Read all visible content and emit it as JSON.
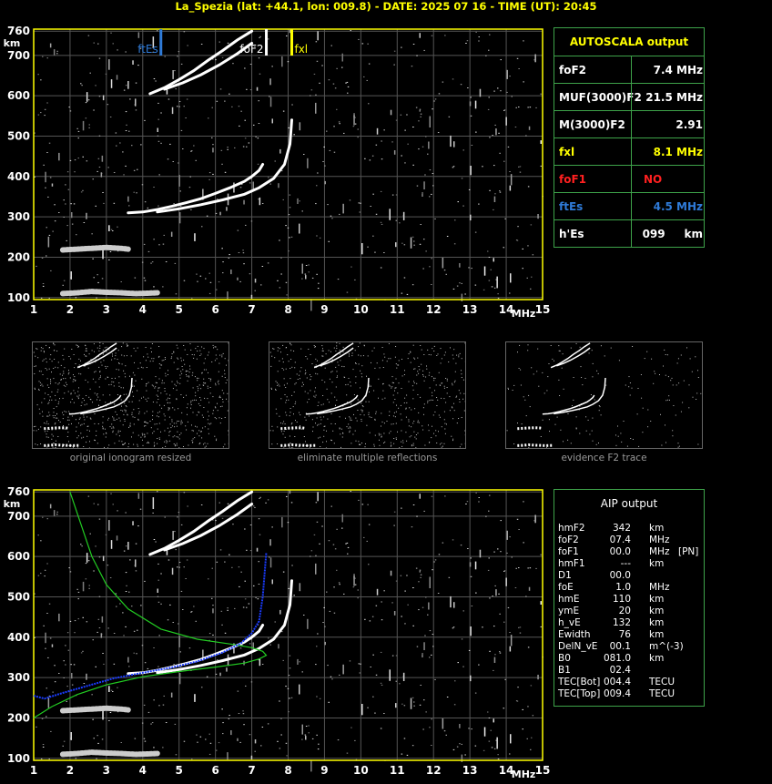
{
  "header": {
    "title": "La_Spezia (lat: +44.1, lon: 009.8) - DATE: 2025 07 16 - TIME (UT): 20:45"
  },
  "colors": {
    "axis": "#ffff00",
    "grid": "#555555",
    "panel_border": "#3ea34a",
    "fte": "#2f7bd8",
    "fof2": "#ffffff",
    "fxl": "#ffff00",
    "model": "#22cc22",
    "profile": "#1a3cff",
    "nofof1": "#ff2020"
  },
  "chart_data": [
    {
      "type": "scatter",
      "name_panel": "top-ionogram",
      "xlabel": "MHz",
      "ylabel": "km",
      "xlim": [
        1,
        15
      ],
      "ylim": [
        95,
        765
      ],
      "xticks": [
        1,
        2,
        3,
        4,
        5,
        6,
        7,
        8,
        9,
        10,
        11,
        12,
        13,
        14,
        15
      ],
      "yticks": [
        100,
        200,
        300,
        400,
        500,
        600,
        700,
        760
      ],
      "grid": true,
      "markers": [
        {
          "label": "ftEs",
          "x": 4.5,
          "color": "#2f7bd8"
        },
        {
          "label": "foF2",
          "x": 7.4,
          "color": "#ffffff"
        },
        {
          "label": "fxl",
          "x": 8.1,
          "color": "#ffff00"
        }
      ],
      "traces": [
        {
          "name": "o-trace",
          "x": [
            3.6,
            4.0,
            4.4,
            4.8,
            5.2,
            5.6,
            6.0,
            6.4,
            6.8,
            7.0,
            7.2,
            7.3
          ],
          "y": [
            310,
            312,
            318,
            326,
            335,
            345,
            358,
            372,
            388,
            400,
            415,
            430
          ]
        },
        {
          "name": "x-trace",
          "x": [
            4.4,
            5.0,
            5.6,
            6.2,
            6.8,
            7.2,
            7.6,
            7.9,
            8.05,
            8.1
          ],
          "y": [
            312,
            320,
            330,
            342,
            356,
            372,
            395,
            430,
            480,
            540
          ]
        },
        {
          "name": "2nd-hop",
          "x": [
            4.2,
            4.6,
            5.0,
            5.4,
            5.8,
            6.2,
            6.6,
            7.0
          ],
          "y": [
            605,
            620,
            640,
            662,
            688,
            712,
            738,
            760
          ]
        },
        {
          "name": "2nd-hop-x",
          "x": [
            4.6,
            5.1,
            5.6,
            6.1,
            6.6,
            7.0
          ],
          "y": [
            616,
            632,
            652,
            676,
            704,
            730
          ]
        },
        {
          "name": "Es-1",
          "x": [
            1.8,
            2.2,
            2.6,
            3.0,
            3.4,
            3.8,
            4.2,
            4.4
          ],
          "y": [
            110,
            112,
            115,
            113,
            112,
            110,
            111,
            112
          ]
        },
        {
          "name": "Es-2",
          "x": [
            1.8,
            2.2,
            2.6,
            3.0,
            3.4,
            3.6
          ],
          "y": [
            218,
            220,
            222,
            224,
            222,
            220
          ]
        }
      ]
    },
    {
      "type": "scatter",
      "name_panel": "bottom-ionogram",
      "xlabel": "MHz",
      "ylabel": "km",
      "xlim": [
        1,
        15
      ],
      "ylim": [
        95,
        765
      ],
      "xticks": [
        1,
        2,
        3,
        4,
        5,
        6,
        7,
        8,
        9,
        10,
        11,
        12,
        13,
        14,
        15
      ],
      "yticks": [
        100,
        200,
        300,
        400,
        500,
        600,
        700,
        760
      ],
      "grid": true,
      "model_curve": {
        "x": [
          1.0,
          1.5,
          2.2,
          3.0,
          4.0,
          5.0,
          6.0,
          6.8,
          7.2,
          7.4,
          7.3,
          7.0,
          6.5,
          5.5,
          4.5,
          3.6,
          3.0,
          2.6,
          2.3,
          2.0
        ],
        "y": [
          200,
          228,
          258,
          282,
          302,
          315,
          326,
          336,
          346,
          355,
          365,
          374,
          382,
          395,
          420,
          470,
          530,
          600,
          680,
          760
        ]
      },
      "profile_curve": {
        "x": [
          1.0,
          1.3,
          1.8,
          2.5,
          3.2,
          4.0,
          4.8,
          5.5,
          6.2,
          6.7,
          7.0,
          7.2,
          7.3,
          7.4
        ],
        "y": [
          255,
          248,
          262,
          280,
          298,
          312,
          325,
          340,
          362,
          385,
          410,
          440,
          500,
          610
        ]
      }
    }
  ],
  "autoscala": {
    "title": "AUTOSCALA output",
    "rows": [
      {
        "label": "foF2",
        "value": "7.4 MHz",
        "color": "#ffffff"
      },
      {
        "label": "MUF(3000)F2",
        "value": "21.5 MHz",
        "color": "#ffffff"
      },
      {
        "label": "M(3000)F2",
        "value": "2.91",
        "color": "#ffffff"
      },
      {
        "label": "fxl",
        "value": "8.1 MHz",
        "color": "#ffff00"
      },
      {
        "label": "foF1",
        "value": "NO",
        "color": "#ff2020"
      },
      {
        "label": "ftEs",
        "value": "4.5 MHz",
        "color": "#2f7bd8"
      },
      {
        "label": "h'Es",
        "value": "099     km",
        "color": "#ffffff"
      }
    ]
  },
  "aip": {
    "title": "AIP output",
    "rows": [
      {
        "label": "hmF2",
        "value": "342",
        "unit": "km",
        "extra": ""
      },
      {
        "label": "foF2",
        "value": "07.4",
        "unit": "MHz",
        "extra": ""
      },
      {
        "label": "foF1",
        "value": "00.0",
        "unit": "MHz",
        "extra": "[PN]"
      },
      {
        "label": "hmF1",
        "value": "---",
        "unit": "km",
        "extra": ""
      },
      {
        "label": "D1",
        "value": "00.0",
        "unit": "",
        "extra": ""
      },
      {
        "label": "foE",
        "value": "1.0",
        "unit": "MHz",
        "extra": ""
      },
      {
        "label": "hmE",
        "value": "110",
        "unit": "km",
        "extra": ""
      },
      {
        "label": "ymE",
        "value": "20",
        "unit": "km",
        "extra": ""
      },
      {
        "label": "h_vE",
        "value": "132",
        "unit": "km",
        "extra": ""
      },
      {
        "label": "Ewidth",
        "value": "76",
        "unit": "km",
        "extra": ""
      },
      {
        "label": "DelN_vE",
        "value": "00.1",
        "unit": "m^(-3)",
        "extra": ""
      },
      {
        "label": "B0",
        "value": "081.0",
        "unit": "km",
        "extra": ""
      },
      {
        "label": "B1",
        "value": "02.4",
        "unit": "",
        "extra": ""
      },
      {
        "label": "TEC[Bot]",
        "value": "004.4",
        "unit": "TECU",
        "extra": ""
      },
      {
        "label": "TEC[Top]",
        "value": "009.4",
        "unit": "TECU",
        "extra": ""
      }
    ]
  },
  "thumbnails": [
    {
      "caption": "original ionogram resized"
    },
    {
      "caption": "eliminate multiple reflections"
    },
    {
      "caption": "evidence F2 trace"
    }
  ]
}
